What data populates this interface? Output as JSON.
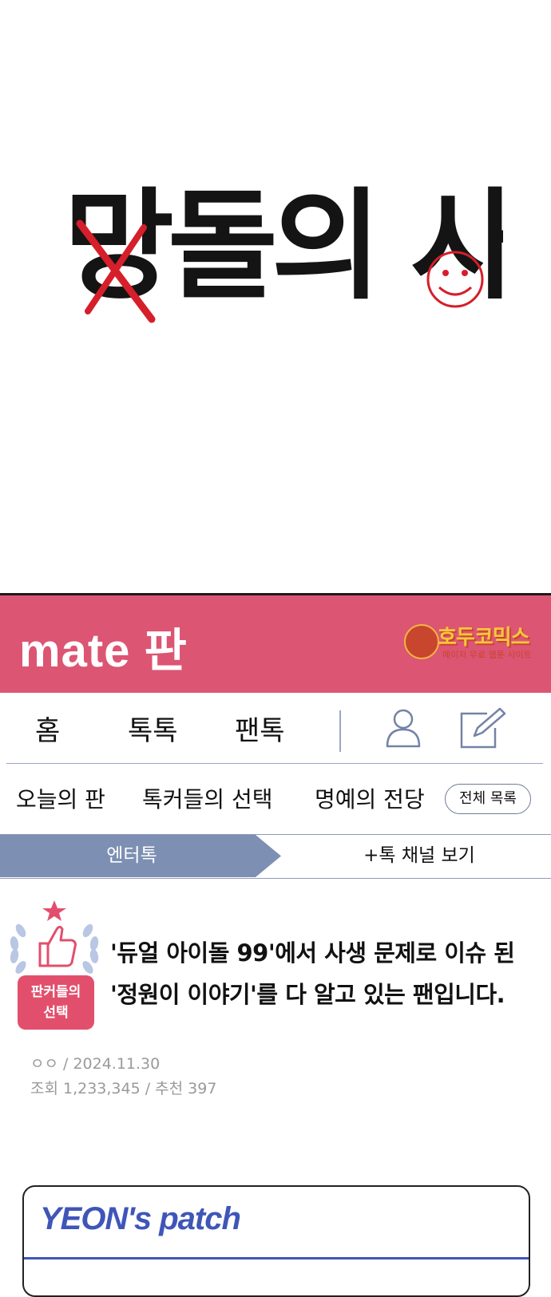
{
  "comic": {
    "title": "망돌의 사생"
  },
  "header": {
    "logo": "mate 판",
    "watermark_title": "호두코믹스",
    "watermark_subtitle": "메이저 무료 웹툰 사이트",
    "brand_color": "#dc5573"
  },
  "nav": {
    "home": "홈",
    "toktok": "톡톡",
    "fantok": "팬톡",
    "profile_icon": "user-icon",
    "write_icon": "pencil-edit-icon"
  },
  "subnav": {
    "today": "오늘의 판",
    "talkers_choice": "톡커들의 선택",
    "hall_of_fame": "명예의 전당",
    "all_list": "전체 목록"
  },
  "channel": {
    "active_tab": "엔터톡",
    "link": "+톡 채널 보기",
    "active_color": "#7d8fb3"
  },
  "post": {
    "badge_line1": "판커들의",
    "badge_line2": "선택",
    "badge_icon": "thumbs-up-icon",
    "title_line1": "'듀얼 아이돌 99'에서 사생 문제로 이슈 된",
    "title_line2": "'정원이 이야기'를 다 알고 있는 팬입니다.",
    "meta_line1": "ㅇㅇ / 2024.11.30",
    "meta_line2": "조회 1,233,345 / 추천 397"
  },
  "patch": {
    "title": "YEON's patch"
  }
}
